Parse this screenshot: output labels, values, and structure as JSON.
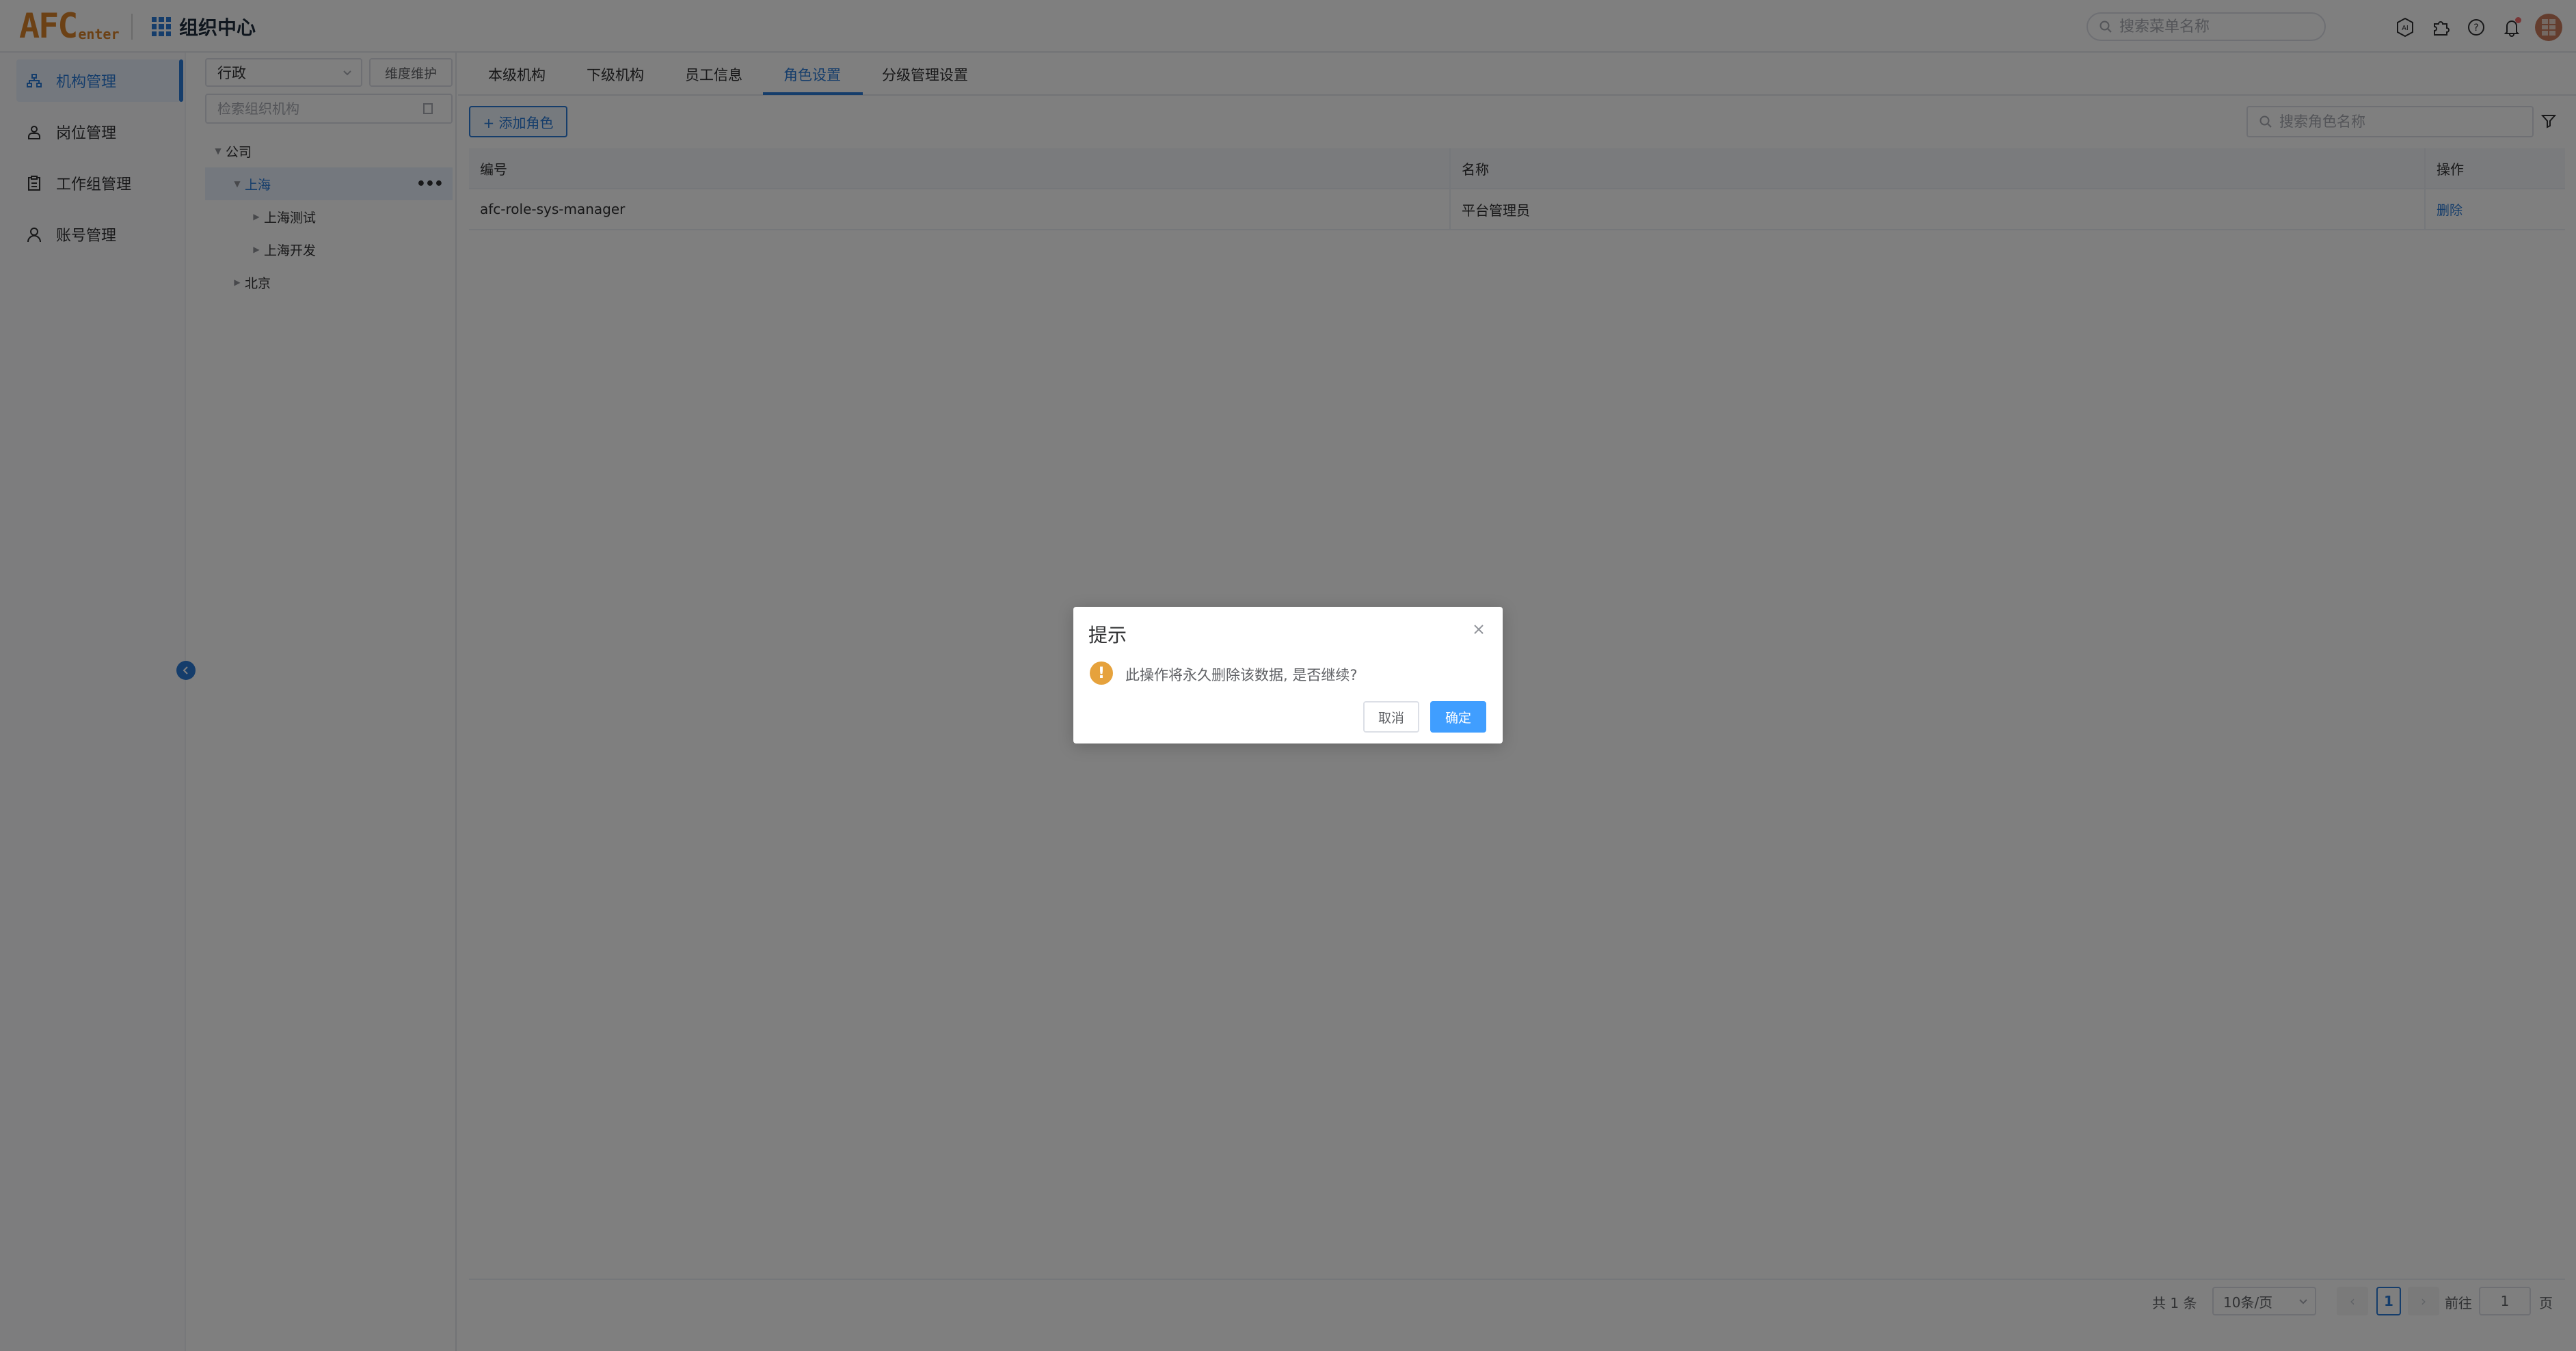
{
  "header": {
    "logo_main": "AFC",
    "logo_sub": "enter",
    "app_title": "组织中心",
    "search_placeholder": "搜索菜单名称",
    "icons": [
      "ai-icon",
      "puzzle-icon",
      "help-icon",
      "bell-icon",
      "avatar"
    ]
  },
  "sidebar": {
    "items": [
      {
        "label": "机构管理",
        "icon": "org-icon",
        "active": true
      },
      {
        "label": "岗位管理",
        "icon": "post-icon",
        "active": false
      },
      {
        "label": "工作组管理",
        "icon": "clipboard-icon",
        "active": false
      },
      {
        "label": "账号管理",
        "icon": "user-icon",
        "active": false
      }
    ]
  },
  "tree": {
    "dimension_value": "行政",
    "dimension_button": "维度维护",
    "search_placeholder": "检索组织机构",
    "nodes": [
      {
        "label": "公司"
      },
      {
        "label": "上海",
        "selected": true
      },
      {
        "label": "上海测试"
      },
      {
        "label": "上海开发"
      },
      {
        "label": "北京"
      }
    ]
  },
  "tabs": [
    {
      "label": "本级机构"
    },
    {
      "label": "下级机构"
    },
    {
      "label": "员工信息"
    },
    {
      "label": "角色设置",
      "active": true
    },
    {
      "label": "分级管理设置"
    }
  ],
  "toolbar": {
    "add_role_label": "+ 添加角色",
    "search_placeholder": "搜索角色名称"
  },
  "table": {
    "headers": [
      "编号",
      "名称",
      "操作"
    ],
    "rows": [
      {
        "code": "afc-role-sys-manager",
        "name": "平台管理员",
        "action": "删除"
      }
    ]
  },
  "pagination": {
    "total": "共 1 条",
    "page_size": "10条/页",
    "current_page": "1",
    "goto_label": "前往",
    "goto_value": "1",
    "page_suffix": "页"
  },
  "dialog": {
    "title": "提示",
    "message": "此操作将永久删除该数据, 是否继续?",
    "cancel": "取消",
    "confirm": "确定"
  },
  "colors": {
    "primary": "#2b7bd6",
    "confirm_button": "#409eff",
    "warning": "#e6a23c",
    "logo": "#d9822b"
  }
}
